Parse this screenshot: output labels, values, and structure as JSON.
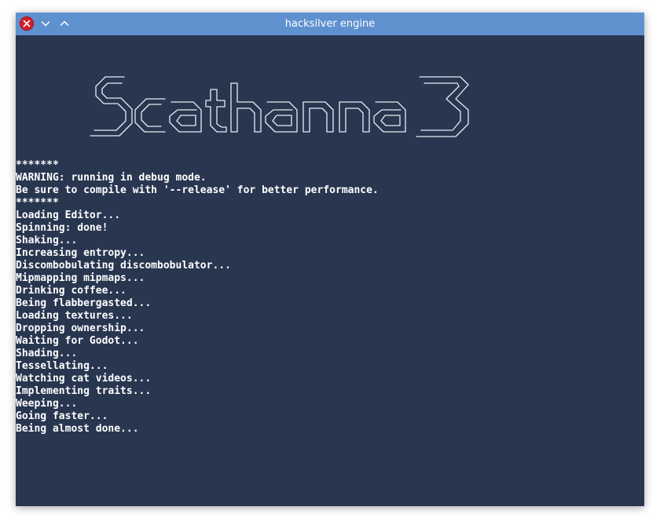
{
  "window": {
    "title": "hacksilver engine",
    "controls": {
      "close": "close-icon",
      "minimize": "chevron-down-icon",
      "maximize": "chevron-up-icon"
    }
  },
  "colors": {
    "titlebar": "#5f91cf",
    "console_background": "#283650",
    "text": "#ffffff",
    "close_button": "#d0202a"
  },
  "logo": {
    "text": "Scathanna 3"
  },
  "console": {
    "lines": [
      "*******",
      "WARNING: running in debug mode.",
      "Be sure to compile with '--release' for better performance.",
      "*******",
      "Loading Editor...",
      "Spinning: done!",
      "Shaking...",
      "Increasing entropy...",
      "Discombobulating discombobulator...",
      "Mipmapping mipmaps...",
      "Drinking coffee...",
      "Being flabbergasted...",
      "Loading textures...",
      "Dropping ownership...",
      "Waiting for Godot...",
      "Shading...",
      "Tessellating...",
      "Watching cat videos...",
      "Implementing traits...",
      "Weeping...",
      "Going faster...",
      "Being almost done..."
    ]
  }
}
